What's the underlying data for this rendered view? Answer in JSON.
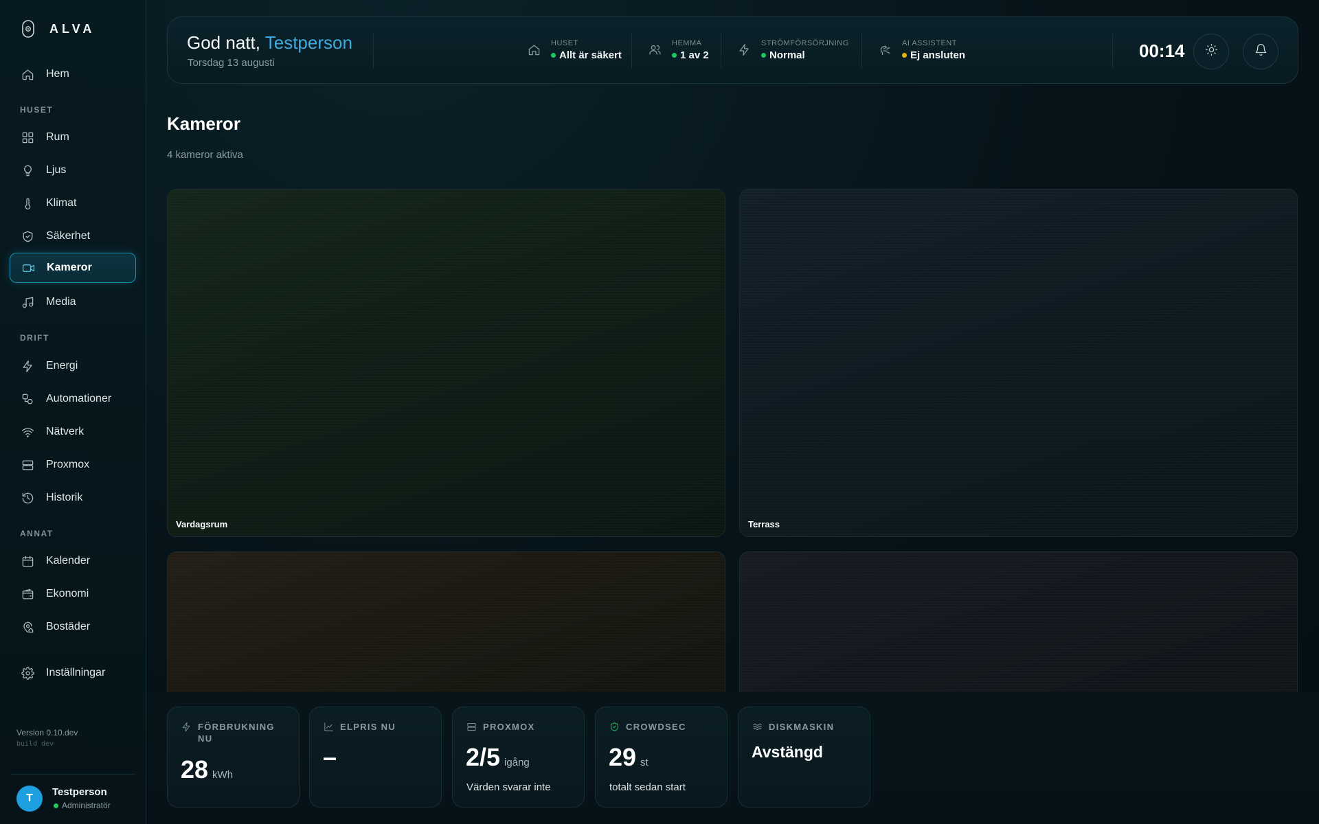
{
  "app": {
    "brand": "ALVA"
  },
  "sidebar": {
    "top_items": [
      {
        "label": "Hem",
        "icon": "home-icon"
      }
    ],
    "sections": [
      {
        "title": "HUSET",
        "items": [
          {
            "label": "Rum",
            "icon": "grid-icon"
          },
          {
            "label": "Ljus",
            "icon": "lightbulb-icon"
          },
          {
            "label": "Klimat",
            "icon": "thermometer-icon"
          },
          {
            "label": "Säkerhet",
            "icon": "shield-icon"
          },
          {
            "label": "Kameror",
            "icon": "video-camera-icon",
            "active": true
          },
          {
            "label": "Media",
            "icon": "music-note-icon"
          }
        ]
      },
      {
        "title": "DRIFT",
        "items": [
          {
            "label": "Energi",
            "icon": "lightning-icon"
          },
          {
            "label": "Automationer",
            "icon": "automation-icon"
          },
          {
            "label": "Nätverk",
            "icon": "wifi-icon"
          },
          {
            "label": "Proxmox",
            "icon": "server-icon"
          },
          {
            "label": "Historik",
            "icon": "history-icon"
          }
        ]
      },
      {
        "title": "ANNAT",
        "items": [
          {
            "label": "Kalender",
            "icon": "calendar-icon"
          },
          {
            "label": "Ekonomi",
            "icon": "wallet-icon"
          },
          {
            "label": "Bostäder",
            "icon": "location-home-icon"
          }
        ]
      }
    ],
    "settings": {
      "label": "Inställningar",
      "icon": "gear-icon"
    },
    "version": "Version 0.10.dev",
    "build": "build dev",
    "user": {
      "initial": "T",
      "name": "Testperson",
      "role": "Administratör",
      "status_color": "#22c55e"
    }
  },
  "header": {
    "greeting": "God natt,",
    "name": "Testperson",
    "date": "Torsdag 13 augusti",
    "stats": [
      {
        "label": "HUSET",
        "value": "Allt är säkert",
        "status_color": "#22c55e",
        "icon": "home-icon"
      },
      {
        "label": "HEMMA",
        "value": "1 av 2",
        "status_color": "#22c55e",
        "icon": "users-icon"
      },
      {
        "label": "STRÖMFÖRSÖRJNING",
        "value": "Normal",
        "status_color": "#22c55e",
        "icon": "lightning-icon"
      },
      {
        "label": "AI ASSISTENT",
        "value": "Ej ansluten",
        "status_color": "#eab308",
        "icon": "ai-icon"
      }
    ],
    "clock": "00:14",
    "theme_icon": "sun-icon",
    "notifications_icon": "bell-icon"
  },
  "main": {
    "title": "Kameror",
    "subtitle": "4 kameror aktiva",
    "cameras": [
      {
        "label": "Vardagsrum"
      },
      {
        "label": "Terrass"
      },
      {
        "label": ""
      },
      {
        "label": ""
      }
    ]
  },
  "kpis": [
    {
      "title": "FÖRBRUKNING NU",
      "value": "28",
      "unit": "kWh",
      "note": "",
      "icon": "lightning-icon"
    },
    {
      "title": "ELPRIS NU",
      "value": "–",
      "unit": "",
      "note": "",
      "icon": "chart-line-icon"
    },
    {
      "title": "PROXMOX",
      "value": "2/5",
      "unit": "igång",
      "note": "Värden svarar inte",
      "icon": "server-icon"
    },
    {
      "title": "CROWDSEC",
      "value": "29",
      "unit": "st",
      "note": "totalt sedan start",
      "icon": "shield-check-icon"
    },
    {
      "title": "DISKMASKIN",
      "value": "Avstängd",
      "unit": "",
      "note": "",
      "icon": "waves-icon"
    }
  ],
  "colors": {
    "accent": "#3eaadf",
    "active_border": "#1a8fb0",
    "ok": "#22c55e",
    "warn": "#eab308"
  }
}
